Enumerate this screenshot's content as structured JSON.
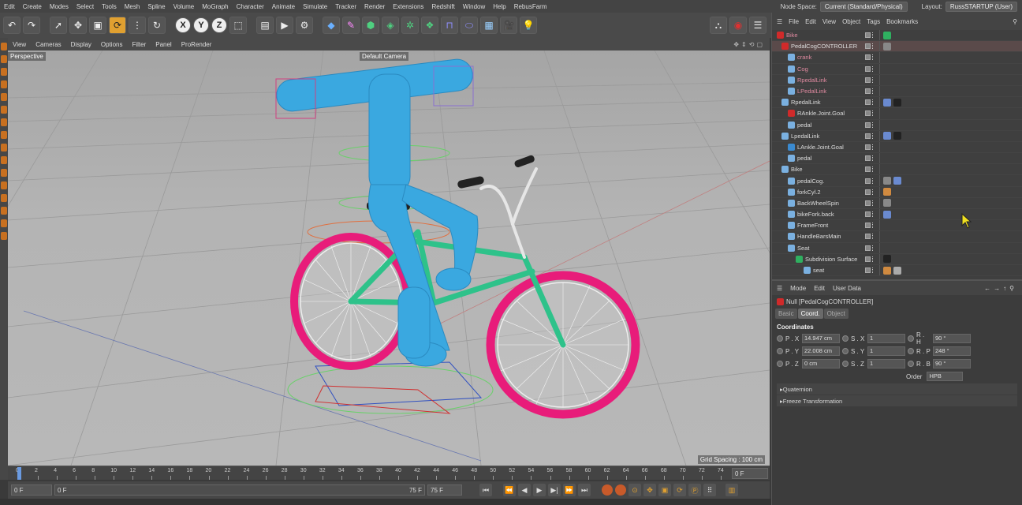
{
  "menubar": {
    "items": [
      "Edit",
      "Create",
      "Modes",
      "Select",
      "Tools",
      "Mesh",
      "Spline",
      "Volume",
      "MoGraph",
      "Character",
      "Animate",
      "Simulate",
      "Tracker",
      "Render",
      "Extensions",
      "Redshift",
      "Window",
      "Help",
      "RebusFarm"
    ],
    "node_space_label": "Node Space:",
    "node_space_value": "Current (Standard/Physical)",
    "layout_label": "Layout:",
    "layout_value": "RussSTARTUP (User)"
  },
  "viewport_menu": {
    "items": [
      "View",
      "Cameras",
      "Display",
      "Options",
      "Filter",
      "Panel",
      "ProRender"
    ],
    "view_name": "Perspective",
    "camera_name": "Default Camera",
    "grid_spacing": "Grid Spacing : 100 cm"
  },
  "timeline": {
    "ticks": [
      "0",
      "2",
      "4",
      "6",
      "8",
      "10",
      "12",
      "14",
      "16",
      "18",
      "20",
      "22",
      "24",
      "26",
      "28",
      "30",
      "32",
      "34",
      "36",
      "38",
      "40",
      "42",
      "44",
      "46",
      "48",
      "50",
      "52",
      "54",
      "56",
      "58",
      "60",
      "62",
      "64",
      "66",
      "68",
      "70",
      "72",
      "74"
    ],
    "current_frame": "0 F"
  },
  "transport": {
    "start_field": "0 F",
    "range_start": "0 F",
    "range_end": "75 F",
    "end_field": "75 F"
  },
  "object_manager": {
    "menu": [
      "File",
      "Edit",
      "View",
      "Object",
      "Tags",
      "Bookmarks"
    ],
    "rows": [
      {
        "name": "Bike",
        "color": "#d02a2a"
      },
      {
        "name": "PedalCogCONTROLLER",
        "color": "#d02a2a"
      },
      {
        "name": "crank",
        "color": "#7ab0e0"
      },
      {
        "name": "Cog",
        "color": "#7ab0e0"
      },
      {
        "name": "RpedalLink",
        "color": "#7ab0e0"
      },
      {
        "name": "LPedalLink",
        "color": "#7ab0e0"
      },
      {
        "name": "RpedalLink",
        "color": "#7ab0e0"
      },
      {
        "name": "RAnkle.Joint.Goal",
        "color": "#d02a2a"
      },
      {
        "name": "pedal",
        "color": "#7ab0e0"
      },
      {
        "name": "LpedalLink",
        "color": "#7ab0e0"
      },
      {
        "name": "LAnkle.Joint.Goal",
        "color": "#3a8ad0"
      },
      {
        "name": "pedal",
        "color": "#7ab0e0"
      },
      {
        "name": "Bike",
        "color": "#7ab0e0"
      },
      {
        "name": "pedalCog.",
        "color": "#7ab0e0"
      },
      {
        "name": "forkCyl.2",
        "color": "#7ab0e0"
      },
      {
        "name": "BackWheelSpin",
        "color": "#7ab0e0"
      },
      {
        "name": "bikeFork.back",
        "color": "#7ab0e0"
      },
      {
        "name": "FrameFront",
        "color": "#7ab0e0"
      },
      {
        "name": "HandleBarsMain",
        "color": "#7ab0e0"
      },
      {
        "name": "Seat",
        "color": "#7ab0e0"
      },
      {
        "name": "Subdivision Surface",
        "color": "#2fb060"
      },
      {
        "name": "seat",
        "color": "#7ab0e0"
      }
    ]
  },
  "attribute_manager": {
    "menu": [
      "Mode",
      "Edit",
      "User Data"
    ],
    "object_title": "Null [PedalCogCONTROLLER]",
    "tabs": [
      "Basic",
      "Coord.",
      "Object"
    ],
    "section": "Coordinates",
    "pos": [
      {
        "label": "P . X",
        "value": "14.947 cm"
      },
      {
        "label": "P . Y",
        "value": "22.008 cm"
      },
      {
        "label": "P . Z",
        "value": "0 cm"
      }
    ],
    "scale": [
      {
        "label": "S . X",
        "value": "1"
      },
      {
        "label": "S . Y",
        "value": "1"
      },
      {
        "label": "S . Z",
        "value": "1"
      }
    ],
    "rot": [
      {
        "label": "R . H",
        "value": "90 °"
      },
      {
        "label": "R . P",
        "value": "248 °"
      },
      {
        "label": "R . B",
        "value": "90 °"
      }
    ],
    "order_label": "Order",
    "order_value": "HPB",
    "folds": [
      "Quaternion",
      "Freeze Transformation"
    ]
  },
  "colors": {
    "tire": "#e81c7a",
    "frame": "#2ec28a",
    "character": "#3aa8e0",
    "accent": "#e0a030"
  }
}
